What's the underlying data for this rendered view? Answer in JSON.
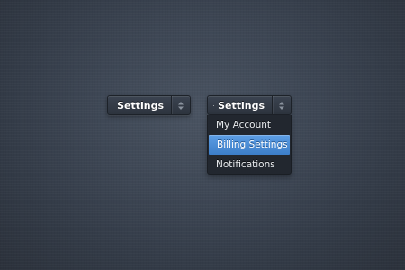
{
  "colors": {
    "background": "#3e4755",
    "menu_background": "#22272f",
    "accent_selected": "#4a8bd5",
    "text": "#ffffff"
  },
  "select_closed": {
    "label": "Settings",
    "icon": "gear-icon",
    "arrow_icon": "up-down-arrows-icon"
  },
  "select_open": {
    "label": "Settings",
    "icon": "gear-icon",
    "arrow_icon": "up-down-arrows-icon",
    "options": [
      {
        "label": "My Account",
        "selected": false
      },
      {
        "label": "Billing Settings",
        "selected": true
      },
      {
        "label": "Notifications",
        "selected": false
      }
    ]
  }
}
